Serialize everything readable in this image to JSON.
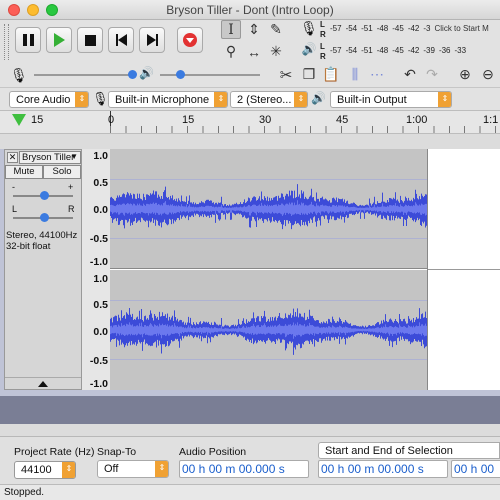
{
  "window": {
    "title": "Bryson Tiller - Dont (Intro Loop)"
  },
  "colors": {
    "accent": "#f0a133",
    "waveform": "#3c4bd8",
    "wave_bg": "#c4c4c4",
    "selection_bg": "#ffffff",
    "timecode_text": "#1b5fcc"
  },
  "transport": {
    "pause_icon": "pause-icon",
    "play_icon": "play-icon",
    "stop_icon": "stop-icon",
    "skip_start_icon": "skip-to-start-icon",
    "skip_end_icon": "skip-to-end-icon",
    "record_icon": "record-icon"
  },
  "meters": {
    "record_labels": [
      "L",
      "R"
    ],
    "record_scale": [
      "-57",
      "-54",
      "-51",
      "-48",
      "-45",
      "-42",
      "-3"
    ],
    "record_hint": "Click to Start M",
    "play_scale": [
      "-57",
      "-54",
      "-51",
      "-48",
      "-45",
      "-42",
      "-39",
      "-36",
      "-33"
    ]
  },
  "devices": {
    "host": "Core Audio",
    "input_device": "Built-in Microphone",
    "channels": "2 (Stereo...",
    "output_device": "Built-in Output"
  },
  "ruler": {
    "labels": [
      "15",
      "0",
      "15",
      "30",
      "45",
      "1:00",
      "1:1"
    ]
  },
  "track": {
    "name": "Bryson Tiller",
    "mute_label": "Mute",
    "solo_label": "Solo",
    "gain_minus": "-",
    "gain_plus": "+",
    "pan_left": "L",
    "pan_right": "R",
    "info_line1": "Stereo, 44100Hz",
    "info_line2": "32-bit float",
    "scale": [
      "1.0",
      "0.5",
      "0.0",
      "-0.5",
      "-1.0"
    ]
  },
  "bottom": {
    "project_rate_label": "Project Rate (Hz)",
    "project_rate_value": "44100",
    "snap_to_label": "Snap-To",
    "snap_to_value": "Off",
    "audio_position_label": "Audio Position",
    "audio_position_value": "00 h 00 m 00.000 s",
    "selection_mode": "Start and End of Selection",
    "selection_start": "00 h 00 m 00.000 s",
    "selection_end": "00 h 00"
  },
  "status": {
    "text": "Stopped."
  }
}
